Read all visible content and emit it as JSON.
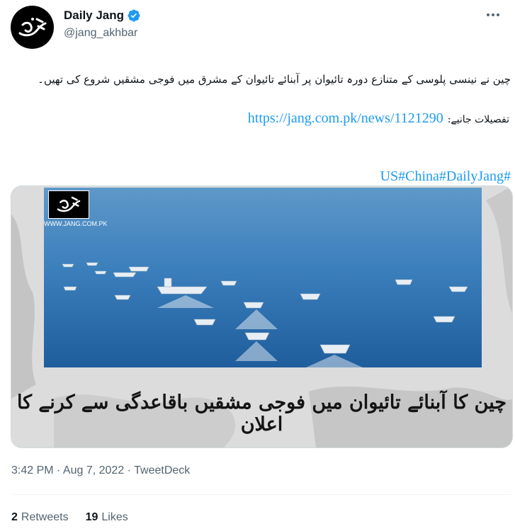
{
  "author": {
    "display_name": "Daily Jang",
    "handle": "@jang_akhbar",
    "avatar_text": "جنگ",
    "verified": true
  },
  "tweet": {
    "line1": "چین نے نینسی پلوسی کے متنازع دورہ تائیوان پر آبنائے تائیوان کے مشرق میں فوجی مشقیں شروع کی تھیں۔",
    "details_label": "تفصیلات جانیے:",
    "link": "https://jang.com.pk/news/1121290",
    "hashtags": "US#China#DailyJang#"
  },
  "media": {
    "logo_text": "جنگ",
    "watermark": "WWW.JANG.COM.PK",
    "headline": "چین کا آبنائے تائیوان میں فوجی مشقیں باقاعدگی سے کرنے کا اعلان"
  },
  "meta": {
    "timestamp": "3:42 PM · Aug 7, 2022 · TweetDeck"
  },
  "stats": {
    "retweets_count": "2",
    "retweets_label": "Retweets",
    "likes_count": "19",
    "likes_label": "Likes"
  },
  "colors": {
    "link": "#1d9bf0",
    "verified": "#1d9bf0",
    "secondary_text": "#536471",
    "sea": "#2b73b5"
  }
}
